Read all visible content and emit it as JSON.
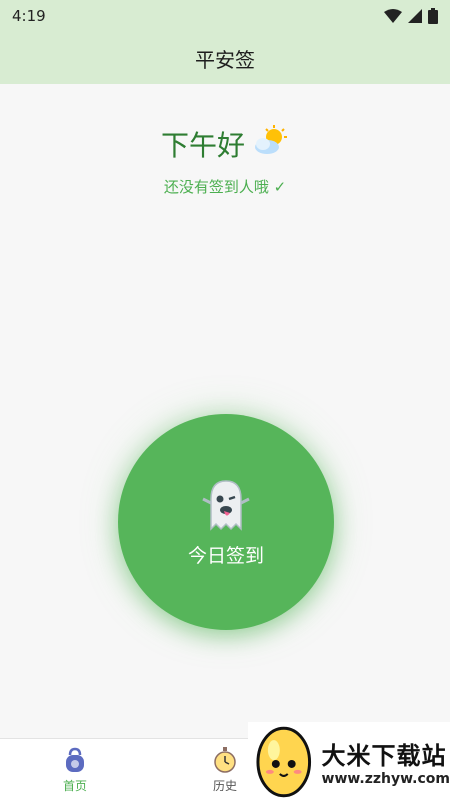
{
  "status_bar": {
    "time": "4:19"
  },
  "app_bar": {
    "title": "平安签"
  },
  "main": {
    "greeting": "下午好",
    "greeting_emoji": "⛅",
    "subtext": "还没有签到人哦 ✓",
    "signin_button_label": "今日签到",
    "signin_button_icon": "ghost-icon"
  },
  "bottom_nav": {
    "items": [
      {
        "label": "首页",
        "icon": "kettlebell-icon",
        "active": true
      },
      {
        "label": "历史",
        "icon": "stopwatch-icon",
        "active": false
      }
    ]
  },
  "watermark": {
    "title": "大米下载站",
    "url": "www.zzhyw.com"
  },
  "colors": {
    "primary": "#56b55a",
    "header_bg": "#d8ecd2",
    "greeting": "#2e7d32",
    "subtext": "#4caf50"
  }
}
